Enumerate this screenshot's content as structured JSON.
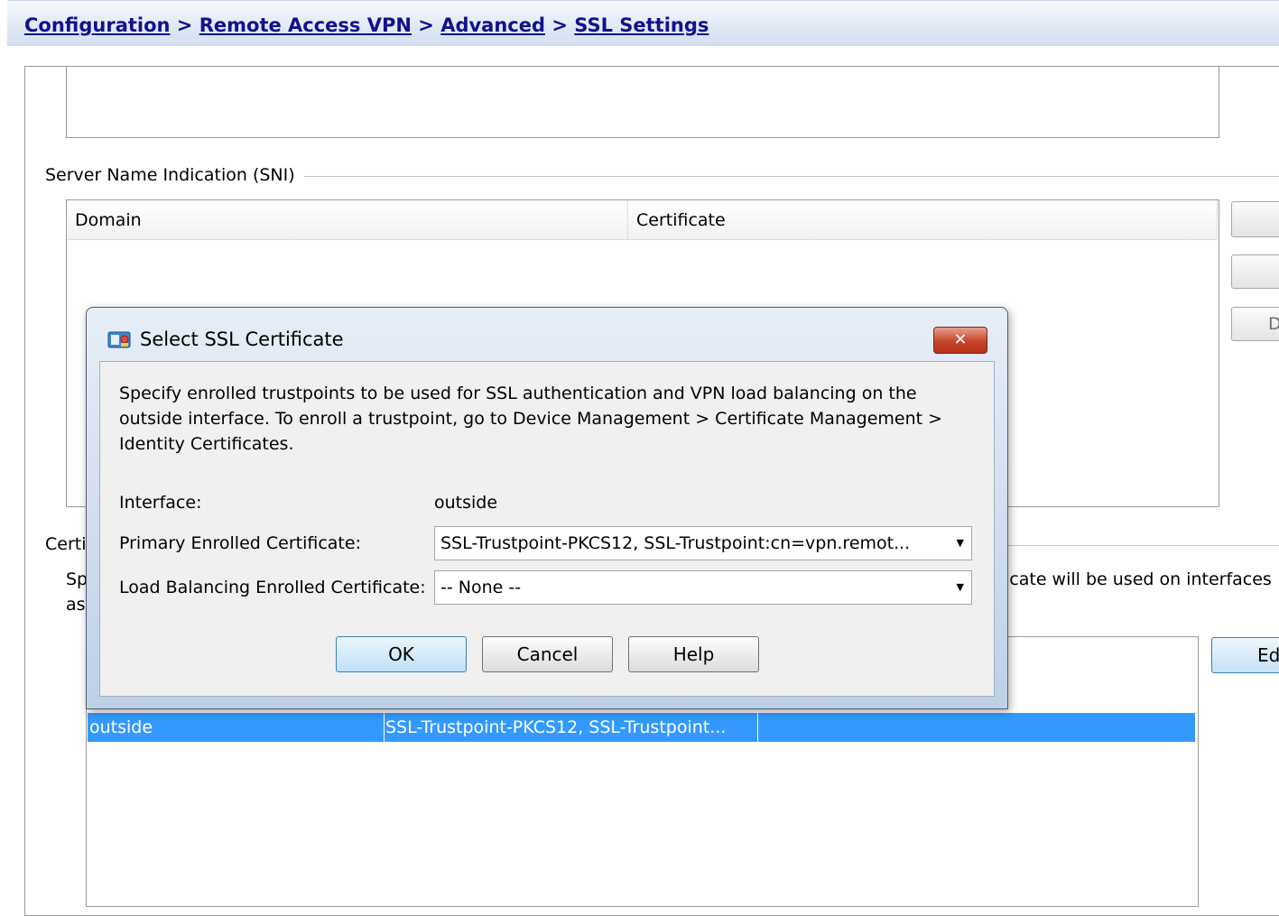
{
  "breadcrumb": {
    "items": [
      "Configuration",
      "Remote Access VPN",
      "Advanced",
      "SSL Settings"
    ],
    "separator": ">"
  },
  "sni": {
    "group_label": "Server Name Indication (SNI)",
    "columns": [
      "Domain",
      "Certificate"
    ],
    "side_buttons": [
      "",
      "",
      "D"
    ]
  },
  "certificates": {
    "group_label": "Certi",
    "desc_line1": "Sp",
    "desc_line2": "as",
    "desc_right": "icate will be used on interfaces",
    "rows": [
      {
        "interface": "outside",
        "certificate": "SSL-Trustpoint-PKCS12, SSL-Trustpoint..."
      }
    ],
    "edit_button": "Ed"
  },
  "dialog": {
    "title": "Select SSL Certificate",
    "close_glyph": "✕",
    "description": "Specify enrolled trustpoints to be used for SSL authentication and VPN load balancing on the outside interface. To enroll a trustpoint, go to Device Management > Certificate Management > Identity Certificates.",
    "interface_label": "Interface:",
    "interface_value": "outside",
    "primary_label": "Primary Enrolled Certificate:",
    "primary_value": "SSL-Trustpoint-PKCS12, SSL-Trustpoint:cn=vpn.remot...",
    "lb_label": "Load Balancing Enrolled Certificate:",
    "lb_value": "-- None --",
    "ok": "OK",
    "cancel": "Cancel",
    "help": "Help"
  },
  "colors": {
    "breadcrumb_link": "#10128c",
    "selection": "#3399ff",
    "close_button": "#c7442b"
  }
}
